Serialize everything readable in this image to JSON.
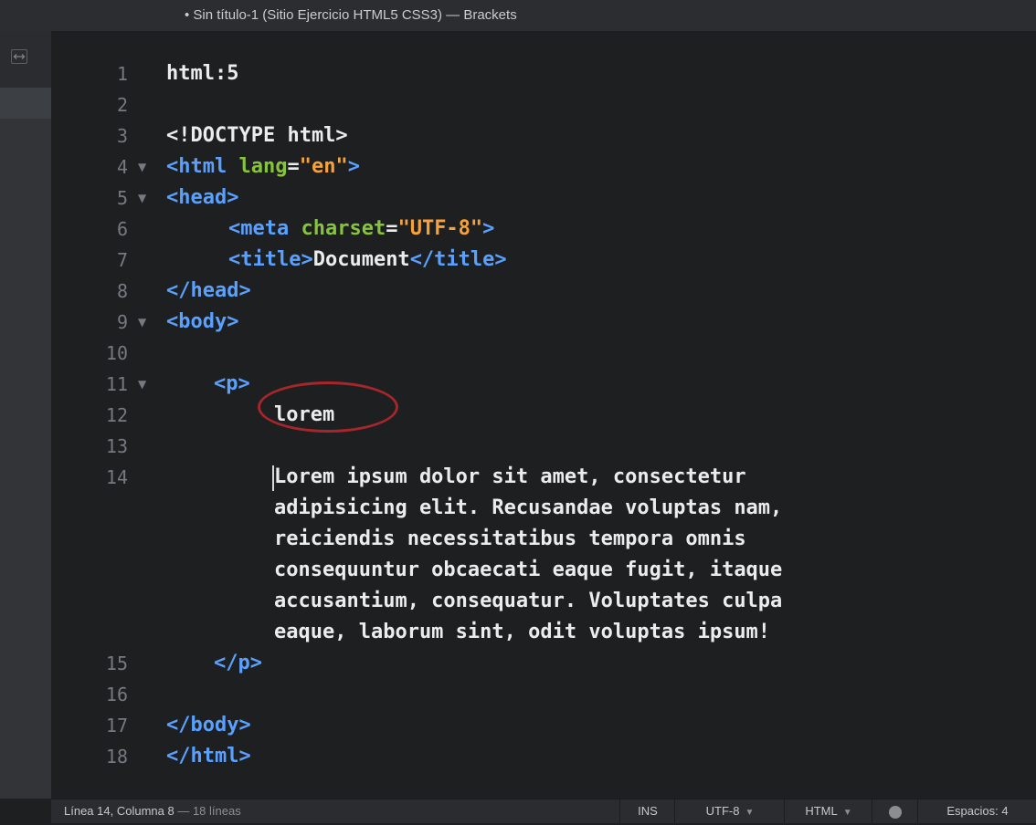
{
  "window": {
    "title": "• Sin título-1 (Sitio Ejercicio HTML5 CSS3) — Brackets"
  },
  "editor": {
    "lines": [
      {
        "n": "1"
      },
      {
        "n": "2"
      },
      {
        "n": "3"
      },
      {
        "n": "4"
      },
      {
        "n": "5"
      },
      {
        "n": "6"
      },
      {
        "n": "7"
      },
      {
        "n": "8"
      },
      {
        "n": "9"
      },
      {
        "n": "10"
      },
      {
        "n": "11"
      },
      {
        "n": "12"
      },
      {
        "n": "13"
      },
      {
        "n": "14"
      },
      {
        "n": "15"
      },
      {
        "n": "16"
      },
      {
        "n": "17"
      },
      {
        "n": "18"
      }
    ],
    "fold_marker": "▼",
    "code": {
      "l1": "html:5",
      "l3": "<!DOCTYPE html>",
      "l4_open": "<html",
      "l4_attr": "lang",
      "l4_eq": "=",
      "l4_val": "\"en\"",
      "l4_close": ">",
      "l5": "<head>",
      "l6_open": "<meta",
      "l6_attr": "charset",
      "l6_eq": "=",
      "l6_val": "\"UTF-8\"",
      "l6_close": ">",
      "l7_open": "<title>",
      "l7_text": "Document",
      "l7_close": "</title>",
      "l8": "</head>",
      "l9": "<body>",
      "l11": "<p>",
      "l12": "lorem",
      "l14": [
        "Lorem ipsum dolor sit amet, consectetur",
        "adipisicing elit. Recusandae voluptas nam,",
        "reiciendis necessitatibus tempora omnis",
        "consequuntur obcaecati eaque fugit, itaque",
        "accusantium, consequatur. Voluptates culpa",
        "eaque, laborum sint, odit voluptas ipsum!"
      ],
      "l15": "</p>",
      "l17": "</body>",
      "l18": "</html>"
    }
  },
  "statusbar": {
    "position": "Línea 14, Columna 8",
    "separator": " — ",
    "line_count": "18 líneas",
    "mode": "INS",
    "encoding": "UTF-8",
    "language": "HTML",
    "indent": "Espacios: 4",
    "dropdown_arrow": "▼"
  },
  "colors": {
    "tag": "#5aa1ff",
    "attribute": "#86c43b",
    "string": "#f6a23a",
    "highlight_circle": "#a5262b"
  }
}
